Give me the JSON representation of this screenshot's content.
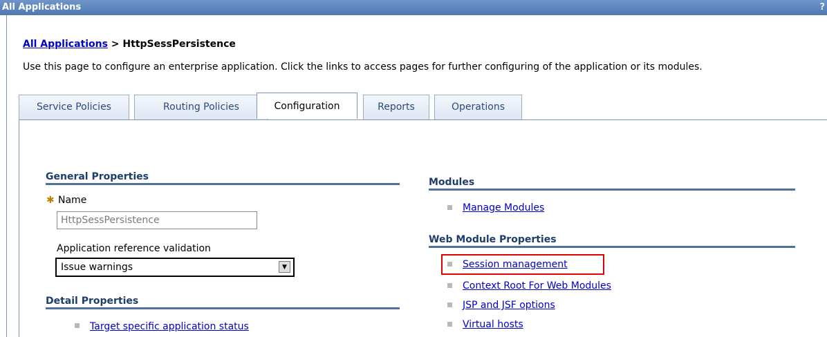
{
  "window": {
    "title": "All Applications",
    "help": "?"
  },
  "breadcrumb": {
    "link": "All Applications",
    "separator": " > ",
    "current": "HttpSessPersistence"
  },
  "description": "Use this page to configure an enterprise application. Click the links to access pages for further configuring of the application or its modules.",
  "tabs": [
    {
      "label": "Service Policies"
    },
    {
      "label": "Routing Policies"
    },
    {
      "label": "Configuration",
      "active": true
    },
    {
      "label": "Reports"
    },
    {
      "label": "Operations"
    }
  ],
  "general": {
    "heading": "General Properties",
    "name_label": "Name",
    "name_value": "HttpSessPersistence",
    "validation_label": "Application reference validation",
    "validation_value": "Issue warnings"
  },
  "detail": {
    "heading": "Detail Properties",
    "links": [
      "Target specific application status"
    ]
  },
  "modules": {
    "heading": "Modules",
    "links": [
      "Manage Modules"
    ]
  },
  "web_module": {
    "heading": "Web Module Properties",
    "links": [
      "Session management",
      "Context Root For Web Modules",
      "JSP and JSF options",
      "Virtual hosts"
    ]
  },
  "colors": {
    "titlebar": "#5a82bb",
    "link": "#0000cc",
    "highlight": "#e00000"
  }
}
